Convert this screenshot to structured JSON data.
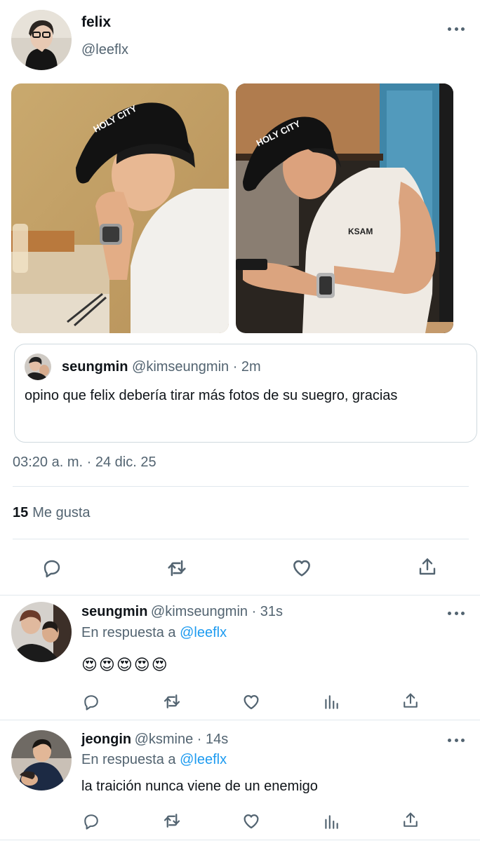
{
  "tweet": {
    "author_name": "felix",
    "author_handle": "@leeflx",
    "timestamp": "03:20 a. m. · 24 dic. 25",
    "likes_count": "15",
    "likes_label": "Me gusta",
    "photo1_cap_text": "HOLY CITY",
    "photo2_cap_text": "HOLY CITY",
    "shirt_text": "KSAM"
  },
  "quote": {
    "name": "seungmin",
    "handle_time": "@kimseungmin · 2m",
    "text": "opino que felix debería tirar más fotos de su suegro, gracias"
  },
  "replies": [
    {
      "name": "seungmin",
      "handle_time": "@kimseungmin · 31s",
      "reply_prefix": "En respuesta a",
      "reply_to": "@leeflx",
      "text": "😍😍😍😍😍"
    },
    {
      "name": "jeongin",
      "handle_time": "@ksmine · 14s",
      "reply_prefix": "En respuesta a",
      "reply_to": "@leeflx",
      "text": "la traición nunca viene de un enemigo"
    }
  ],
  "icons": {
    "reply": "reply-icon",
    "retweet": "retweet-icon",
    "like": "heart-icon",
    "share": "share-icon",
    "views": "views-icon",
    "more": "more-icon"
  },
  "colors": {
    "link": "#1d9bf0",
    "muted": "#536471",
    "text": "#0f1419",
    "divider": "#e1e8ed"
  }
}
